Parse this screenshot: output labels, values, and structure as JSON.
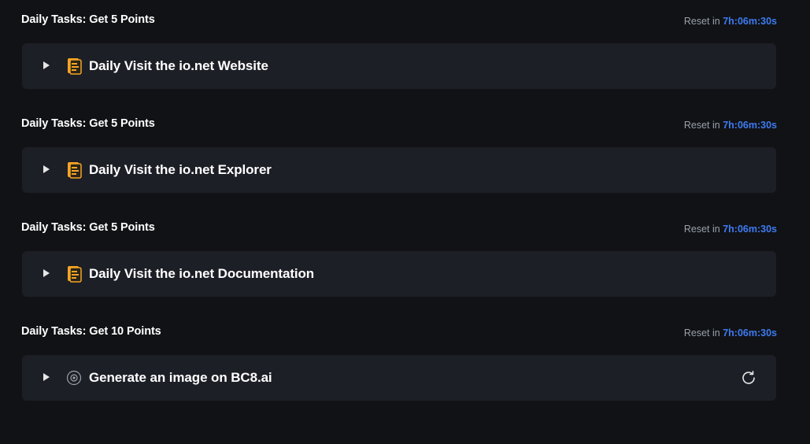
{
  "sections": [
    {
      "title": "Daily Tasks: Get 5 Points",
      "reset_label": "Reset in",
      "reset_time": "7h:06m:30s",
      "task_label": "Daily Visit the io.net Website",
      "icon": "document-icon"
    },
    {
      "title": "Daily Tasks: Get 5 Points",
      "reset_label": "Reset in",
      "reset_time": "7h:06m:30s",
      "task_label": "Daily Visit the io.net Explorer",
      "icon": "document-icon"
    },
    {
      "title": "Daily Tasks: Get 5 Points",
      "reset_label": "Reset in",
      "reset_time": "7h:06m:30s",
      "task_label": "Daily Visit the io.net Documentation",
      "icon": "document-icon"
    },
    {
      "title": "Daily Tasks: Get 10 Points",
      "reset_label": "Reset in",
      "reset_time": "7h:06m:30s",
      "task_label": "Generate an image on BC8.ai",
      "icon": "target-icon",
      "has_refresh": true
    }
  ],
  "colors": {
    "background": "#111216",
    "card": "#1d1f26",
    "accent_time": "#3d7bf0",
    "icon_orange": "#f5a524"
  }
}
